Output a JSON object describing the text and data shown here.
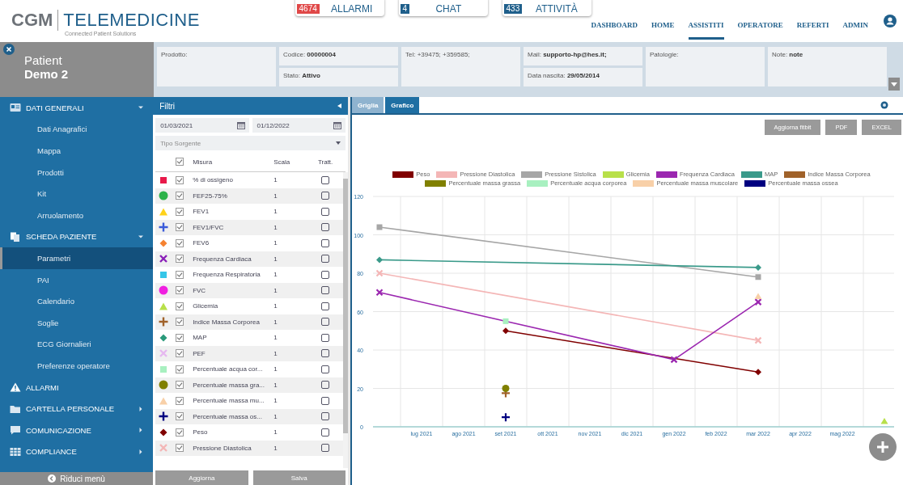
{
  "header": {
    "logo": "CGM",
    "brand": "TELEMEDICINE",
    "tagline": "Connected Patient Solutions",
    "counters": [
      {
        "count": "4674",
        "label": "ALLARMI",
        "color": "#e04848"
      },
      {
        "count": "4",
        "label": "CHAT",
        "color": "#1f5f8b"
      },
      {
        "count": "433",
        "label": "ATTIVITÀ",
        "color": "#1f5f8b"
      }
    ],
    "nav": [
      {
        "label": "DASHBOARD",
        "selected": false
      },
      {
        "label": "HOME",
        "selected": false
      },
      {
        "label": "ASSISTITI",
        "selected": true
      },
      {
        "label": "OPERATORE",
        "selected": false
      },
      {
        "label": "REFERTI",
        "selected": false
      },
      {
        "label": "ADMIN",
        "selected": false
      }
    ]
  },
  "patient": {
    "label": "Patient",
    "name": "Demo 2",
    "info": [
      [
        "Prodotto:"
      ],
      [
        "Codice: **00000004**",
        "Stato: **Attivo**"
      ],
      [
        "Tel: +39475; +359585;"
      ],
      [
        "Mail: **supporto-hp@hes.it;**",
        "Data nascita: **29/05/2014**"
      ],
      [
        "Patologie:"
      ],
      [
        "Note: **note**"
      ]
    ]
  },
  "sidebar": {
    "sections": [
      {
        "label": "DATI GENERALI",
        "kind": "group",
        "expanded": true,
        "children": [
          {
            "label": "Dati Anagrafici",
            "selected": false
          },
          {
            "label": "Mappa",
            "selected": false
          },
          {
            "label": "Prodotti",
            "selected": false
          },
          {
            "label": "Kit",
            "selected": false
          },
          {
            "label": "Arruolamento",
            "selected": false
          }
        ]
      },
      {
        "label": "SCHEDA PAZIENTE",
        "kind": "group",
        "expanded": true,
        "children": [
          {
            "label": "Parametri",
            "selected": true
          },
          {
            "label": "PAI",
            "selected": false
          },
          {
            "label": "Calendario",
            "selected": false
          },
          {
            "label": "Soglie",
            "selected": false
          },
          {
            "label": "ECG Giornalieri",
            "selected": false
          },
          {
            "label": "Preferenze operatore",
            "selected": false
          }
        ]
      },
      {
        "label": "ALLARMI",
        "kind": "link"
      },
      {
        "label": "CARTELLA PERSONALE",
        "kind": "group",
        "expanded": false
      },
      {
        "label": "COMUNICAZIONE",
        "kind": "group",
        "expanded": false
      },
      {
        "label": "COMPLIANCE",
        "kind": "group",
        "expanded": false
      }
    ],
    "collapse": "Riduci menù"
  },
  "filters": {
    "title": "Filtri",
    "date_from": "01/03/2021",
    "date_to": "01/12/2022",
    "source_placeholder": "Tipo Sorgente",
    "columns": [
      "Misura",
      "Scala",
      "Tratt."
    ],
    "all_checked": true,
    "rows": [
      {
        "color": "#e8194a",
        "checked": true,
        "name": "% di ossigeno",
        "scale": "1",
        "treated": false
      },
      {
        "color": "#2db34a",
        "checked": true,
        "name": "FEF25-75%",
        "scale": "1",
        "treated": false
      },
      {
        "color": "#ffd21a",
        "checked": true,
        "name": "FEV1",
        "scale": "1",
        "treated": false
      },
      {
        "color": "#3a5bd9",
        "checked": true,
        "name": "FEV1/FVC",
        "scale": "1",
        "treated": false
      },
      {
        "color": "#f58231",
        "checked": true,
        "name": "FEV6",
        "scale": "1",
        "treated": false
      },
      {
        "color": "#8a1fb8",
        "checked": true,
        "name": "Frequenza Cardiaca",
        "scale": "1",
        "treated": false
      },
      {
        "color": "#36c6e8",
        "checked": true,
        "name": "Frequenza Respiratoria",
        "scale": "1",
        "treated": false
      },
      {
        "color": "#f020e0",
        "checked": true,
        "name": "FVC",
        "scale": "1",
        "treated": false
      },
      {
        "color": "#b8e04a",
        "checked": true,
        "name": "Glicemia",
        "scale": "1",
        "treated": false
      },
      {
        "color": "#a0622a",
        "checked": true,
        "name": "Indice Massa Corporea",
        "scale": "1",
        "treated": false
      },
      {
        "color": "#2a9a7a",
        "checked": true,
        "name": "MAP",
        "scale": "1",
        "treated": false
      },
      {
        "color": "#e6b8f0",
        "checked": true,
        "name": "PEF",
        "scale": "1",
        "treated": false
      },
      {
        "color": "#a8f0c0",
        "checked": true,
        "name": "Percentuale acqua cor...",
        "scale": "1",
        "treated": false
      },
      {
        "color": "#808000",
        "checked": true,
        "name": "Percentuale massa gra...",
        "scale": "1",
        "treated": false
      },
      {
        "color": "#f8d0a8",
        "checked": true,
        "name": "Percentuale massa mu...",
        "scale": "1",
        "treated": false
      },
      {
        "color": "#000080",
        "checked": true,
        "name": "Percentuale massa os...",
        "scale": "1",
        "treated": false
      },
      {
        "color": "#800000",
        "checked": true,
        "name": "Peso",
        "scale": "1",
        "treated": false
      },
      {
        "color": "#f4b6b6",
        "checked": true,
        "name": "Pressione Diastolica",
        "scale": "1",
        "treated": false
      }
    ],
    "buttons": [
      "Aggiorna",
      "Salva"
    ]
  },
  "chart_panel": {
    "tabs": [
      {
        "label": "Griglia",
        "selected": false
      },
      {
        "label": "Grafico",
        "selected": true
      }
    ],
    "buttons": [
      "Aggiorna fitbit",
      "PDF",
      "EXCEL"
    ],
    "chart_data": {
      "type": "line",
      "grid": true,
      "legend": true,
      "categories": [
        null,
        "lug 2021",
        "ago 2021",
        "set 2021",
        "ott 2021",
        "nov 2021",
        "dic 2021",
        "gen 2022",
        "feb 2022",
        "mar 2022",
        "apr 2022",
        "mag 2022",
        null
      ],
      "ylim": [
        0,
        120
      ],
      "yticks": [
        0,
        20,
        40,
        60,
        80,
        100,
        120
      ],
      "series": [
        {
          "name": "Peso",
          "color": "#800000",
          "marker": "diamond",
          "values": [
            null,
            null,
            null,
            50,
            null,
            null,
            null,
            null,
            null,
            28.5,
            null,
            null,
            null
          ]
        },
        {
          "name": "Pressione Diastolica",
          "color": "#f4b6b6",
          "marker": "cross",
          "values": [
            80,
            null,
            null,
            null,
            null,
            null,
            null,
            null,
            null,
            45,
            null,
            null,
            null
          ]
        },
        {
          "name": "Pressione Sistolica",
          "color": "#a6a6a6",
          "marker": "square",
          "values": [
            104,
            null,
            null,
            null,
            null,
            null,
            null,
            null,
            null,
            78,
            null,
            null,
            null
          ]
        },
        {
          "name": "Glicemia",
          "color": "#b8e04a",
          "marker": "triangle",
          "values": [
            null,
            null,
            null,
            null,
            null,
            null,
            null,
            null,
            null,
            null,
            null,
            null,
            3
          ]
        },
        {
          "name": "Frequenza Cardiaca",
          "color": "#9b27b0",
          "marker": "cross",
          "values": [
            70,
            null,
            null,
            null,
            null,
            null,
            null,
            35,
            null,
            65,
            null,
            null,
            null
          ]
        },
        {
          "name": "MAP",
          "color": "#3a9a8a",
          "marker": "diamond",
          "values": [
            87,
            null,
            null,
            null,
            null,
            null,
            null,
            null,
            null,
            83,
            null,
            null,
            null
          ]
        },
        {
          "name": "Indice Massa Corporea",
          "color": "#a0622a",
          "marker": "plus",
          "values": [
            null,
            null,
            null,
            17.5,
            null,
            null,
            null,
            null,
            null,
            null,
            null,
            null,
            null
          ]
        },
        {
          "name": "Percentuale massa grassa",
          "color": "#808000",
          "marker": "circle",
          "values": [
            null,
            null,
            null,
            20,
            null,
            null,
            null,
            null,
            null,
            null,
            null,
            null,
            null
          ]
        },
        {
          "name": "Percentuale acqua corporea",
          "color": "#a8f0c0",
          "marker": "square",
          "values": [
            null,
            null,
            null,
            55,
            null,
            null,
            null,
            null,
            null,
            null,
            null,
            null,
            null
          ]
        },
        {
          "name": "Percentuale massa muscolare",
          "color": "#f8d0a8",
          "marker": "triangle",
          "values": [
            null,
            null,
            null,
            null,
            null,
            null,
            null,
            null,
            null,
            68,
            null,
            null,
            null
          ]
        },
        {
          "name": "Percentuale massa ossea",
          "color": "#000080",
          "marker": "plus",
          "values": [
            null,
            null,
            null,
            5,
            null,
            null,
            null,
            null,
            null,
            null,
            null,
            null,
            null
          ]
        }
      ]
    }
  }
}
